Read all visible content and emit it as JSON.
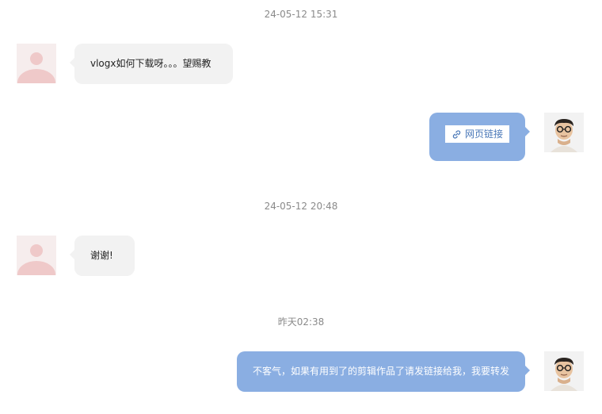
{
  "messages": [
    {
      "timestamp": "24-05-12 15:31"
    },
    {
      "sender": "other",
      "avatar_icon": "default-user-avatar",
      "text": "vlogx如何下载呀。。。望赐教"
    },
    {
      "sender": "self",
      "avatar_icon": "user-photo-avatar",
      "link_label": "网页链接",
      "link_icon": "link-icon"
    },
    {
      "timestamp": "24-05-12 20:48"
    },
    {
      "sender": "other",
      "avatar_icon": "default-user-avatar",
      "text": "谢谢!"
    },
    {
      "timestamp": "昨天02:38"
    },
    {
      "sender": "self",
      "avatar_icon": "user-photo-avatar",
      "text": "不客气，如果有用到了的剪辑作品了请发链接给我，我要转发"
    }
  ],
  "colors": {
    "self_bubble": "#8aaee2",
    "other_bubble": "#f2f2f2",
    "timestamp_text": "#8a8a8a",
    "link_text": "#4a78b8"
  }
}
